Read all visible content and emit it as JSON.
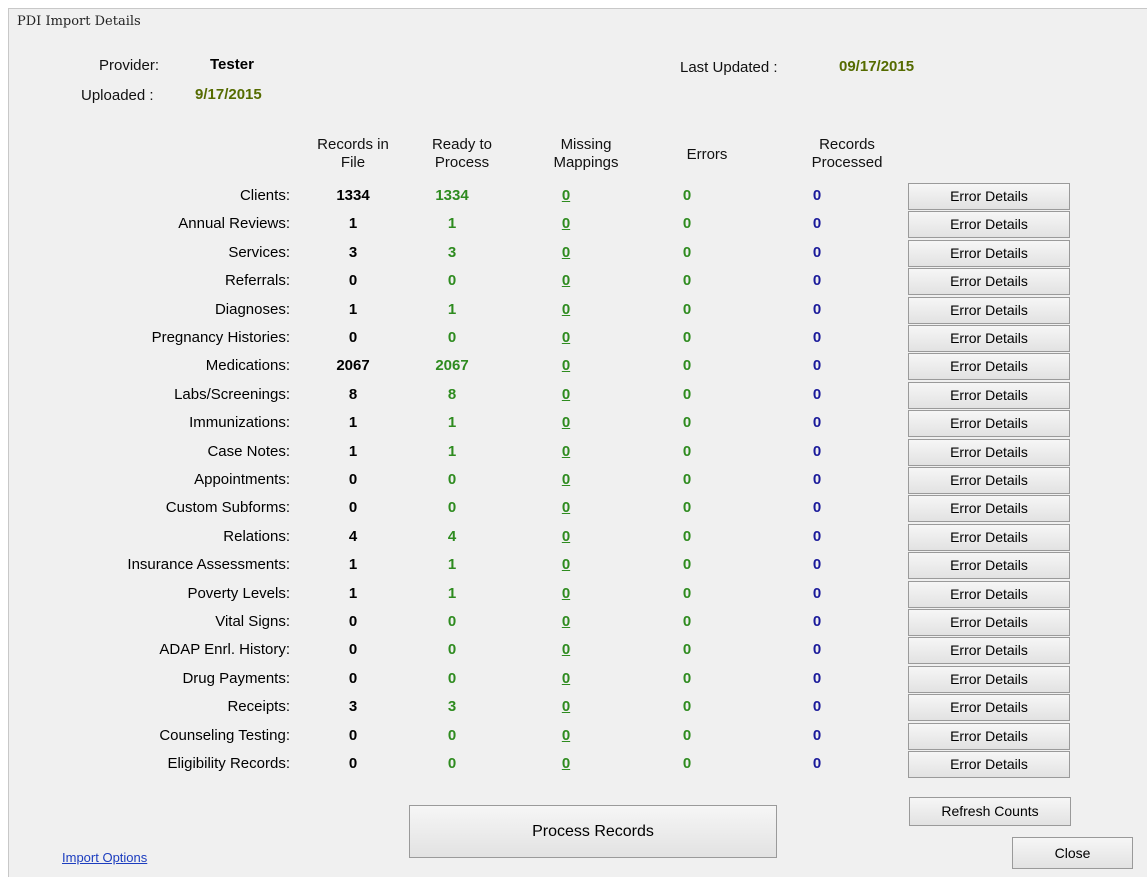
{
  "window": {
    "title": "PDI Import Details"
  },
  "header": {
    "provider_label": "Provider:",
    "provider_value": "Tester",
    "uploaded_label": "Uploaded :",
    "uploaded_value": "9/17/2015",
    "last_updated_label": "Last Updated :",
    "last_updated_value": "09/17/2015"
  },
  "columns": {
    "records_in_file": [
      "Records in",
      "File"
    ],
    "ready_to_process": [
      "Ready to",
      "Process"
    ],
    "missing_mappings": [
      "Missing",
      "Mappings"
    ],
    "errors": [
      "Errors"
    ],
    "records_processed": [
      "Records",
      "Processed"
    ]
  },
  "rows": [
    {
      "label": "Clients:",
      "in_file": "1334",
      "ready": "1334",
      "missing": "0",
      "errors": "0",
      "processed": "0",
      "button": "Error Details"
    },
    {
      "label": "Annual Reviews:",
      "in_file": "1",
      "ready": "1",
      "missing": "0",
      "errors": "0",
      "processed": "0",
      "button": "Error Details"
    },
    {
      "label": "Services:",
      "in_file": "3",
      "ready": "3",
      "missing": "0",
      "errors": "0",
      "processed": "0",
      "button": "Error Details"
    },
    {
      "label": "Referrals:",
      "in_file": "0",
      "ready": "0",
      "missing": "0",
      "errors": "0",
      "processed": "0",
      "button": "Error Details"
    },
    {
      "label": "Diagnoses:",
      "in_file": "1",
      "ready": "1",
      "missing": "0",
      "errors": "0",
      "processed": "0",
      "button": "Error Details"
    },
    {
      "label": "Pregnancy Histories:",
      "in_file": "0",
      "ready": "0",
      "missing": "0",
      "errors": "0",
      "processed": "0",
      "button": "Error Details"
    },
    {
      "label": "Medications:",
      "in_file": "2067",
      "ready": "2067",
      "missing": "0",
      "errors": "0",
      "processed": "0",
      "button": "Error Details"
    },
    {
      "label": "Labs/Screenings:",
      "in_file": "8",
      "ready": "8",
      "missing": "0",
      "errors": "0",
      "processed": "0",
      "button": "Error Details"
    },
    {
      "label": "Immunizations:",
      "in_file": "1",
      "ready": "1",
      "missing": "0",
      "errors": "0",
      "processed": "0",
      "button": "Error Details"
    },
    {
      "label": "Case Notes:",
      "in_file": "1",
      "ready": "1",
      "missing": "0",
      "errors": "0",
      "processed": "0",
      "button": "Error Details"
    },
    {
      "label": "Appointments:",
      "in_file": "0",
      "ready": "0",
      "missing": "0",
      "errors": "0",
      "processed": "0",
      "button": "Error Details"
    },
    {
      "label": "Custom Subforms:",
      "in_file": "0",
      "ready": "0",
      "missing": "0",
      "errors": "0",
      "processed": "0",
      "button": "Error Details"
    },
    {
      "label": "Relations:",
      "in_file": "4",
      "ready": "4",
      "missing": "0",
      "errors": "0",
      "processed": "0",
      "button": "Error Details"
    },
    {
      "label": "Insurance Assessments:",
      "in_file": "1",
      "ready": "1",
      "missing": "0",
      "errors": "0",
      "processed": "0",
      "button": "Error Details"
    },
    {
      "label": "Poverty Levels:",
      "in_file": "1",
      "ready": "1",
      "missing": "0",
      "errors": "0",
      "processed": "0",
      "button": "Error Details"
    },
    {
      "label": "Vital Signs:",
      "in_file": "0",
      "ready": "0",
      "missing": "0",
      "errors": "0",
      "processed": "0",
      "button": "Error Details"
    },
    {
      "label": "ADAP Enrl. History:",
      "in_file": "0",
      "ready": "0",
      "missing": "0",
      "errors": "0",
      "processed": "0",
      "button": "Error Details"
    },
    {
      "label": "Drug Payments:",
      "in_file": "0",
      "ready": "0",
      "missing": "0",
      "errors": "0",
      "processed": "0",
      "button": "Error Details"
    },
    {
      "label": "Receipts:",
      "in_file": "3",
      "ready": "3",
      "missing": "0",
      "errors": "0",
      "processed": "0",
      "button": "Error Details"
    },
    {
      "label": "Counseling Testing:",
      "in_file": "0",
      "ready": "0",
      "missing": "0",
      "errors": "0",
      "processed": "0",
      "button": "Error Details"
    },
    {
      "label": "Eligibility Records:",
      "in_file": "0",
      "ready": "0",
      "missing": "0",
      "errors": "0",
      "processed": "0",
      "button": "Error Details"
    }
  ],
  "footer": {
    "refresh_label": "Refresh Counts",
    "process_label": "Process Records",
    "close_label": "Close",
    "import_options_label": "Import Options"
  },
  "colors": {
    "ready": "#2e8b1f",
    "processed": "#1a1a9a",
    "dates": "#556b00",
    "link": "#1c3dbf"
  }
}
